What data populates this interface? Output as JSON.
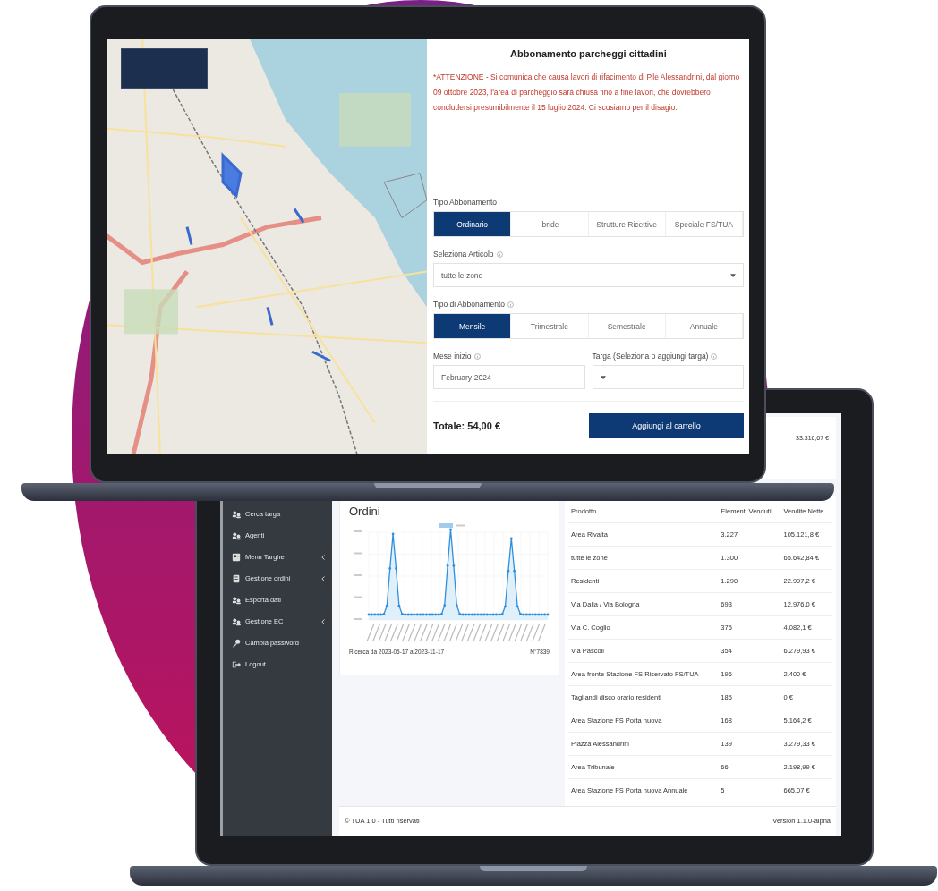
{
  "subscription_app": {
    "title": "Abbonamento parcheggi cittadini",
    "notice": "*ATTENZIONE - Si comunica che causa lavori di rifacimento di P.le Alessandrini, dal giorno 09 ottobre 2023, l'area di parcheggio sarà chiusa fino a fine lavori, che dovrebbero concludersi presumibilmente il 15 luglio 2024. Ci scusiamo per il disagio.",
    "subscription_type": {
      "label": "Tipo Abbonamento",
      "info": false,
      "options": [
        {
          "label": "Ordinario",
          "selected": true
        },
        {
          "label": "Ibride",
          "selected": false
        },
        {
          "label": "Strutture Ricettive",
          "selected": false
        },
        {
          "label": "Speciale FS/TUA",
          "selected": false
        }
      ]
    },
    "article": {
      "label": "Seleziona Articolo",
      "info": true,
      "kind": "select",
      "value": "tutte le zone"
    },
    "duration": {
      "label": "Tipo di Abbonamento",
      "info": true,
      "options": [
        {
          "label": "Mensile",
          "selected": true
        },
        {
          "label": "Trimestrale",
          "selected": false
        },
        {
          "label": "Semestrale",
          "selected": false
        },
        {
          "label": "Annuale",
          "selected": false
        }
      ]
    },
    "fields": [
      {
        "label": "Mese inizio",
        "info": true,
        "kind": "text",
        "value": "February-2024"
      },
      {
        "label": "Targa (Seleziona o aggiungi targa)",
        "info": true,
        "kind": "select"
      }
    ],
    "total": "Totale: 54,00 €",
    "add_button": "Aggiungi al carrello"
  },
  "admin_dashboard": {
    "sidebar": {
      "items": [
        {
          "label": "Cerca targa",
          "has_submenu": false
        },
        {
          "label": "Agenti",
          "has_submenu": false
        },
        {
          "label": "Menu Targhe",
          "has_submenu": true
        },
        {
          "label": "Gestione ordini",
          "has_submenu": true
        },
        {
          "label": "Esporta dati",
          "has_submenu": false
        },
        {
          "label": "Gestione EC",
          "has_submenu": true
        },
        {
          "label": "Cambia password",
          "has_submenu": false
        },
        {
          "label": "Logout",
          "has_submenu": false
        }
      ]
    },
    "summary_value": "33.316,67 €",
    "orders_card": {
      "title": "Ordini",
      "range": "Ricerca da 2023-05-17 a 2023-11-17",
      "count": "N°7839"
    },
    "table": {
      "columns": [
        "Prodotto",
        "Elementi Venduti",
        "Vendite Nette"
      ],
      "rows": [
        [
          "Area Rivalta",
          "3.227",
          "105.121,8 €"
        ],
        [
          "tutte le zone",
          "1.300",
          "65.642,84 €"
        ],
        [
          "Residenti",
          "1.290",
          "22.997,2 €"
        ],
        [
          "Via Dalla / Via Bologna",
          "693",
          "12.976,0 €"
        ],
        [
          "Via C. Coglio",
          "375",
          "4.082,1 €"
        ],
        [
          "Via Pascoli",
          "354",
          "6.279,93 €"
        ],
        [
          "Area fronte Stazione FS Riservato FS/TUA",
          "196",
          "2.400 €"
        ],
        [
          "Tagliandi disco orario residenti",
          "185",
          "0 €"
        ],
        [
          "Area Stazione FS Porta nuova",
          "168",
          "5.164,2 €"
        ],
        [
          "Piazza Alessandrini",
          "139",
          "3.279,33 €"
        ],
        [
          "Area Tribunale",
          "66",
          "2.198,99 €"
        ],
        [
          "Area Stazione FS Porta nuova Annuale",
          "5",
          "665,07 €"
        ]
      ]
    },
    "footer": {
      "copyright": "© TUA 1.0 - Tutti riservati",
      "version": "Version 1.1.0-alpha"
    }
  }
}
